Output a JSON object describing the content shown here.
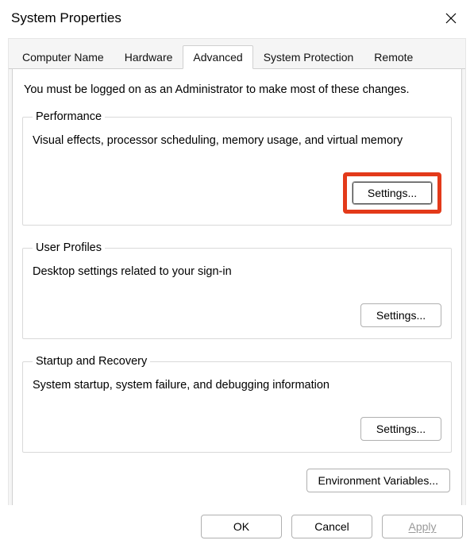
{
  "window": {
    "title": "System Properties"
  },
  "tabs": {
    "computer_name": "Computer Name",
    "hardware": "Hardware",
    "advanced": "Advanced",
    "system_protection": "System Protection",
    "remote": "Remote"
  },
  "advanced_tab": {
    "intro": "You must be logged on as an Administrator to make most of these changes.",
    "performance": {
      "legend": "Performance",
      "desc": "Visual effects, processor scheduling, memory usage, and virtual memory",
      "settings_btn": "Settings..."
    },
    "user_profiles": {
      "legend": "User Profiles",
      "desc": "Desktop settings related to your sign-in",
      "settings_btn": "Settings..."
    },
    "startup_recovery": {
      "legend": "Startup and Recovery",
      "desc": "System startup, system failure, and debugging information",
      "settings_btn": "Settings..."
    },
    "env_vars_btn": "Environment Variables..."
  },
  "footer": {
    "ok": "OK",
    "cancel": "Cancel",
    "apply": "Apply"
  }
}
